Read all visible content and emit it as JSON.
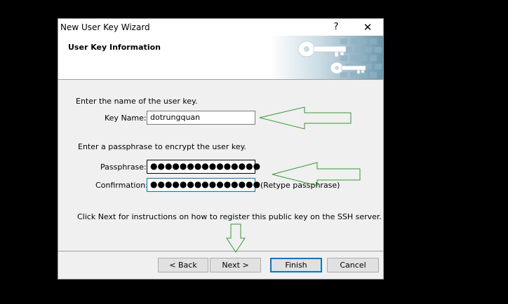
{
  "window": {
    "title": "New User Key Wizard",
    "help_symbol": "?",
    "close_symbol": "✕"
  },
  "header": {
    "title": "User Key Information"
  },
  "form": {
    "name_instruction": "Enter the name of the user key.",
    "key_name_label": "Key Name:",
    "key_name_value": "dotrungquan",
    "passphrase_instruction": "Enter a passphrase to encrypt the user key.",
    "passphrase_label": "Passphrase:",
    "passphrase_mask": "●●●●●●●●●●●●●●●",
    "confirmation_label": "Confirmation:",
    "confirmation_mask": "●●●●●●●●●●●●●●●",
    "retype_hint": "(Retype passphrase)",
    "next_instruction": "Click Next for instructions on how to register this public key on the SSH server."
  },
  "buttons": {
    "back": "< Back",
    "next": "Next >",
    "finish": "Finish",
    "cancel": "Cancel"
  },
  "colors": {
    "annotation_arrow": "#2e9e2e",
    "focus_border": "#0078d7"
  }
}
